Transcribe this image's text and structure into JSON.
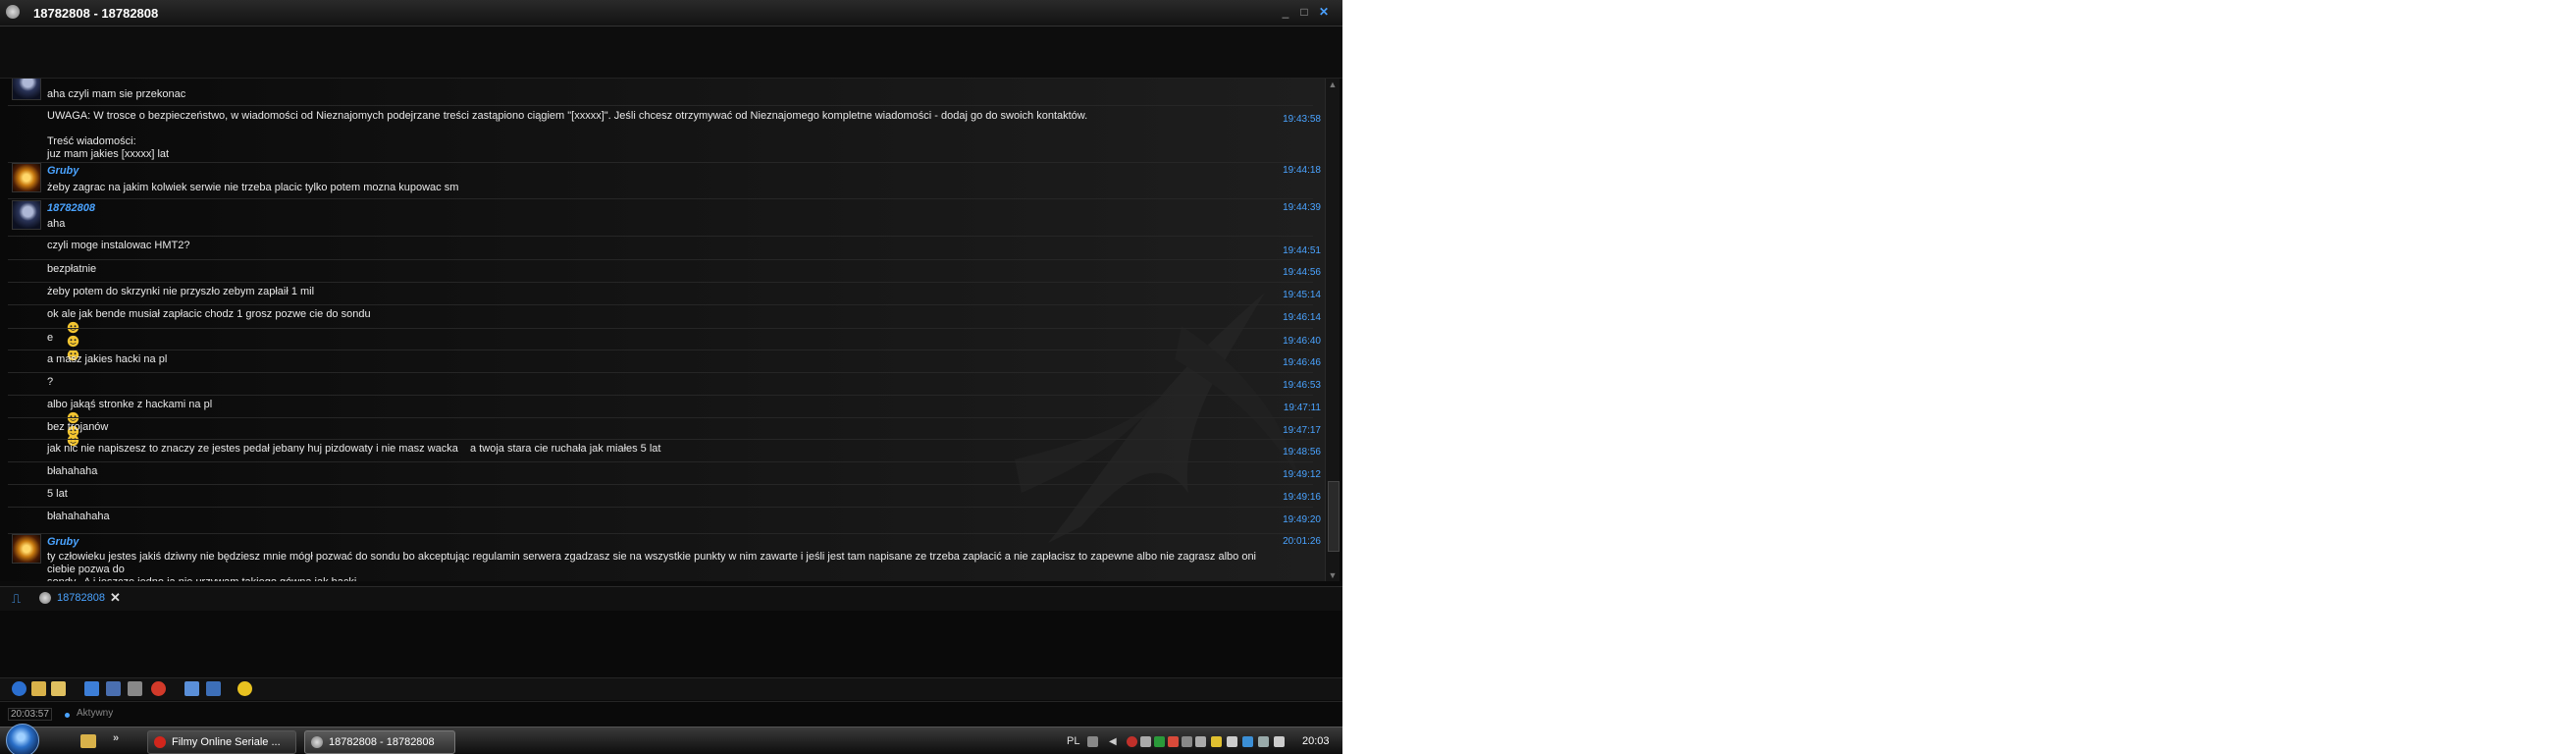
{
  "window": {
    "title": "18782808 - 18782808",
    "minimize": "_",
    "maximize": "□",
    "close": "✕"
  },
  "messages": [
    {
      "text": "aha czyli mam sie przekonac",
      "time": ""
    },
    {
      "text": "UWAGA: W trosce o bezpieczeństwo, w wiadomości od Nieznajomych podejrzane treści zastąpiono ciągiem \"[xxxxx]\". Jeśli chcesz otrzymywać od Nieznajomego kompletne wiadomości - dodaj go do swoich kontaktów.\n\nTreść wiadomości:\njuz mam jakies [xxxxx] lat",
      "time": "19:43:58"
    },
    {
      "sender": "Gruby",
      "time": "19:44:18",
      "text": "żeby zagrac na jakim kolwiek serwie nie trzeba placic tylko potem mozna kupowac sm"
    },
    {
      "sender": "18782808",
      "time": "19:44:39",
      "text": "aha"
    },
    {
      "text": "czyli moge instalowac HMT2?",
      "time": "19:44:51"
    },
    {
      "text": "bezpłatnie",
      "time": "19:44:56"
    },
    {
      "text": "żeby potem do skrzynki nie przyszło zebym zapłaił 1 mil",
      "time": "19:45:14"
    },
    {
      "text": "ok ale jak bende musiał zapłacic chodz 1 grosz pozwe cie do sondu",
      "time": "19:46:14"
    },
    {
      "text": "e",
      "time": "19:46:40"
    },
    {
      "text": "a masz jakies hacki na pl",
      "time": "19:46:46"
    },
    {
      "text": "?",
      "time": "19:46:53"
    },
    {
      "text": "albo jakąś stronke z hackami na pl",
      "time": "19:47:11"
    },
    {
      "text": "bez trojanów",
      "time": "19:47:17"
    },
    {
      "text": "jak nic nie napiszesz to znaczy ze jestes pedał jebany huj pizdowaty i nie masz wacka    a twoja stara cie ruchała jak miałes 5 lat",
      "time": "19:48:56"
    },
    {
      "text": "błahahaha",
      "time": "19:49:12"
    },
    {
      "text": "5 lat",
      "time": "19:49:16"
    },
    {
      "text": "błahahahaha",
      "time": "19:49:20"
    },
    {
      "sender": "Gruby",
      "time": "20:01:26",
      "text": "ty człowieku jestes jakiś dziwny nie będziesz mnie mógł pozwać do sondu bo akceptując regulamin serwera zgadzasz sie na wszystkie punkty w nim zawarte i jeśli jest tam napisane ze trzeba zapłacić a nie zapłacisz to zapewne albo nie zagrasz albo oni ciebie pozwa do\nsondy.  A i jeszcze jedno ja nie urzywam takiego gówna jak hacki"
    }
  ],
  "tabs": [
    {
      "label": "18782808",
      "close": "✕"
    }
  ],
  "status": {
    "time": "20:03:57",
    "state": "Aktywny"
  },
  "taskbar": {
    "chevron": "»",
    "tasks": [
      {
        "label": "Filmy Online Seriale ...",
        "icon": "opera-icon"
      },
      {
        "label": "18782808 - 18782808",
        "icon": "gadu-icon"
      }
    ],
    "lang": "PL",
    "clock": "20:03"
  },
  "colors": {
    "accent": "#4aa3ff",
    "background": "#0b0b0b",
    "text": "#e8e8e8"
  }
}
